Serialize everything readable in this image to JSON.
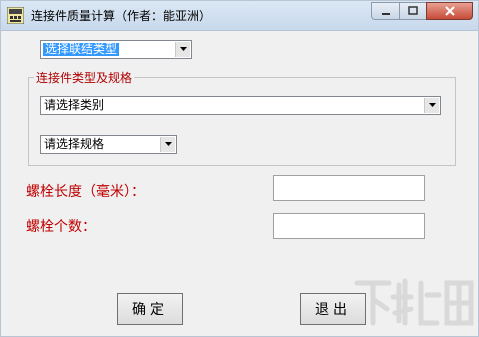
{
  "window": {
    "title": "连接件质量计算（作者：能亚洲）",
    "icon": "app-icon"
  },
  "connection_type": {
    "value": "选择联结类型",
    "selected": true
  },
  "group": {
    "title": "连接件类型及规格",
    "category": {
      "value": "请选择类别"
    },
    "spec": {
      "value": "请选择规格"
    }
  },
  "bolt_length": {
    "label": "螺栓长度（毫米）：",
    "value": ""
  },
  "bolt_count": {
    "label": "螺栓个数：",
    "value": ""
  },
  "buttons": {
    "ok": "确定",
    "exit": "退出"
  },
  "colors": {
    "accent": "#3399ff",
    "label_red": "#c00000",
    "group_title": "#b00000"
  }
}
